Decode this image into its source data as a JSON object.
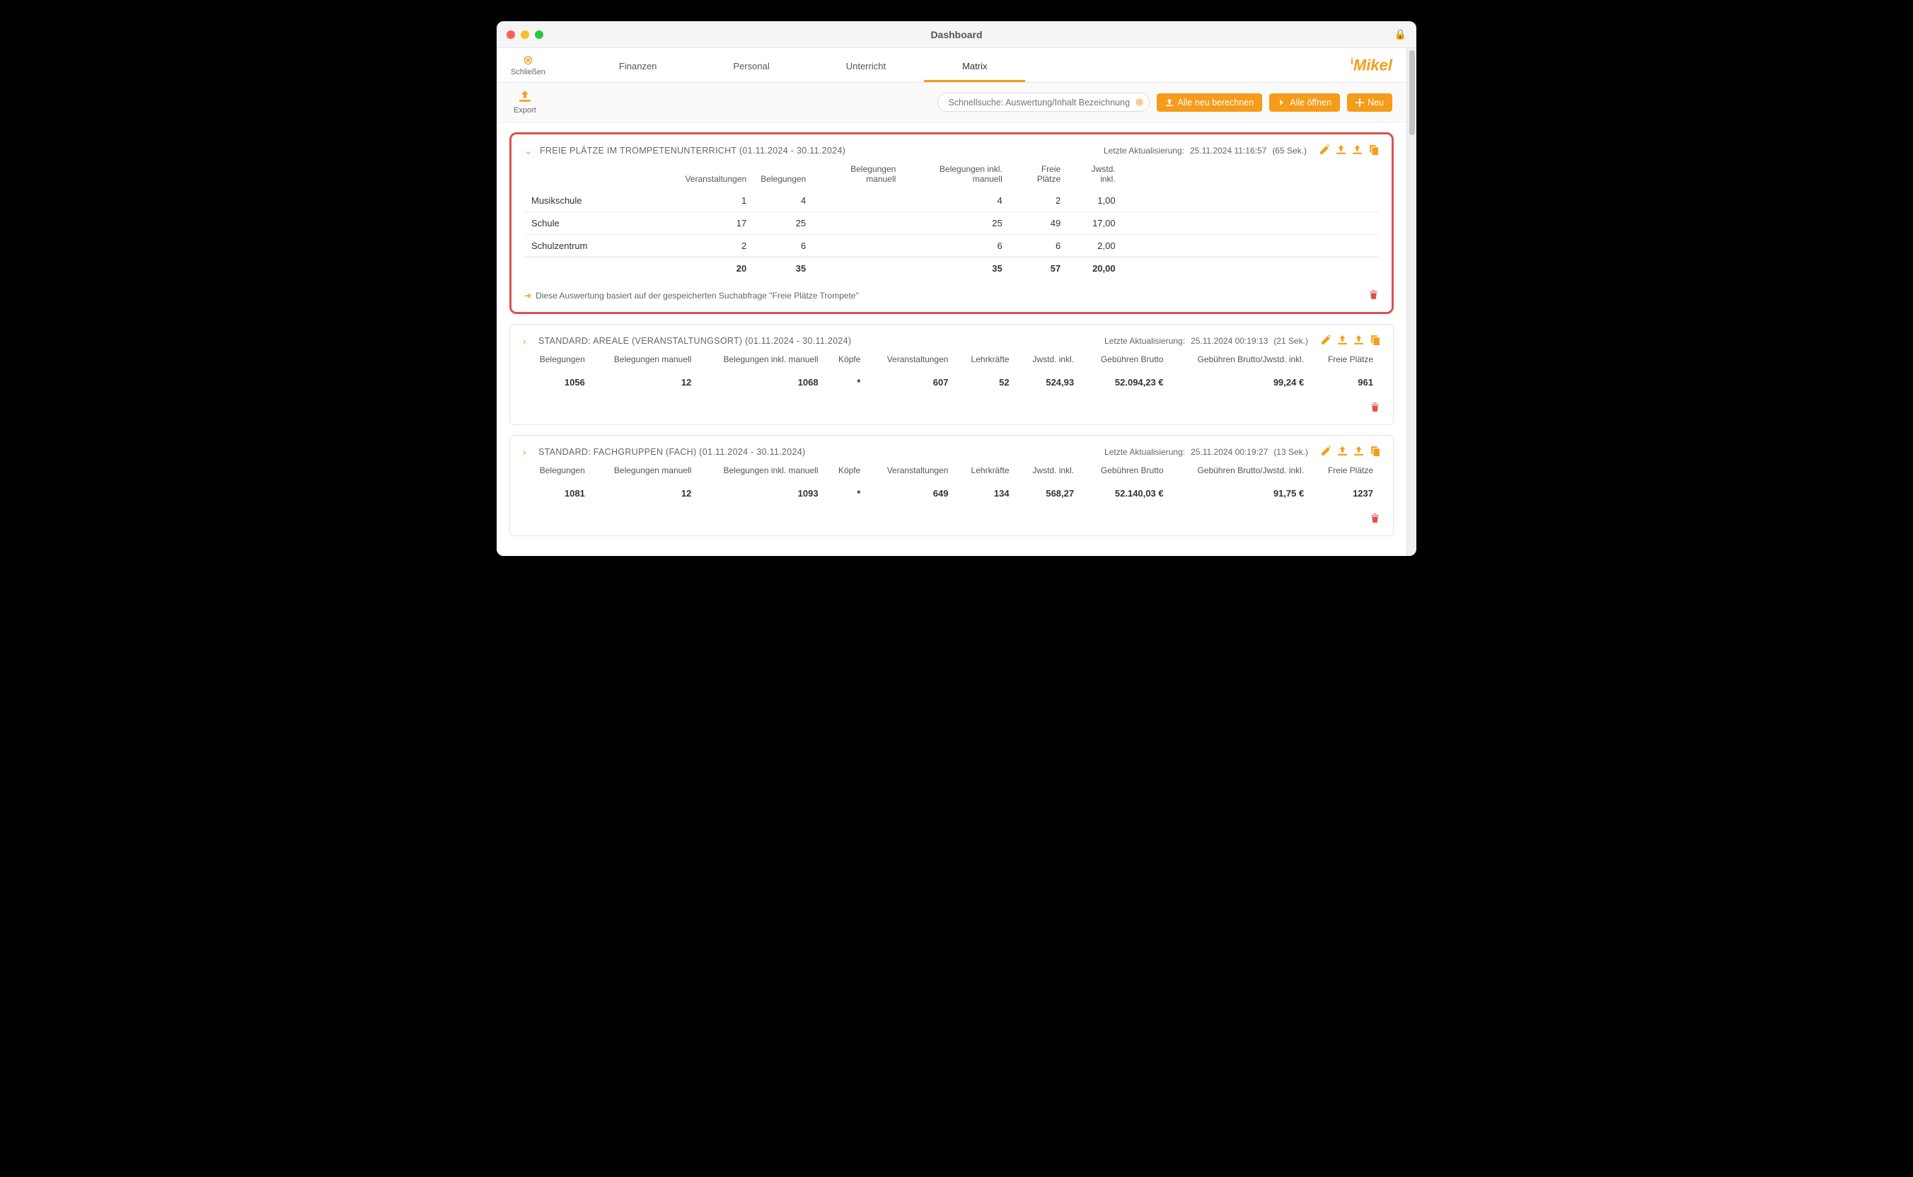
{
  "window": {
    "title": "Dashboard"
  },
  "toolbar": {
    "close_label": "Schließen",
    "export_label": "Export"
  },
  "tabs": {
    "finanzen": "Finanzen",
    "personal": "Personal",
    "unterricht": "Unterricht",
    "matrix": "Matrix"
  },
  "logo": "Mikel",
  "buttons": {
    "recalc": "Alle neu berechnen",
    "open_all": "Alle öffnen",
    "new": "Neu"
  },
  "search": {
    "placeholder": "Schnellsuche: Auswertung/Inhalt Bezeichnung"
  },
  "panel1": {
    "title": "FREIE PLÄTZE IM TROMPETENUNTERRICHT (01.11.2024 - 30.11.2024)",
    "meta_label": "Letzte Aktualisierung:",
    "meta_time": "25.11.2024 11:16:57",
    "meta_dur": "(65 Sek.)",
    "headers": {
      "c1": "Veranstaltungen",
      "c2": "Belegungen",
      "c3": "Belegungen manuell",
      "c4": "Belegungen inkl. manuell",
      "c5": "Freie Plätze",
      "c6": "Jwstd. inkl."
    },
    "rows": [
      {
        "label": "Musikschule",
        "c1": "1",
        "c2": "4",
        "c3": "",
        "c4": "4",
        "c5": "2",
        "c6": "1,00"
      },
      {
        "label": "Schule",
        "c1": "17",
        "c2": "25",
        "c3": "",
        "c4": "25",
        "c5": "49",
        "c6": "17,00"
      },
      {
        "label": "Schulzentrum",
        "c1": "2",
        "c2": "6",
        "c3": "",
        "c4": "6",
        "c5": "6",
        "c6": "2,00"
      }
    ],
    "total": {
      "c1": "20",
      "c2": "35",
      "c3": "",
      "c4": "35",
      "c5": "57",
      "c6": "20,00"
    },
    "footnote": "Diese Auswertung basiert auf der gespeicherten Suchabfrage \"Freie Plätze Trompete\""
  },
  "panel2": {
    "title": "STANDARD: AREALE (VERANSTALTUNGSORT) (01.11.2024 - 30.11.2024)",
    "meta_label": "Letzte Aktualisierung:",
    "meta_time": "25.11.2024 00:19:13",
    "meta_dur": "(21 Sek.)",
    "headers": {
      "c1": "Belegungen",
      "c2": "Belegungen manuell",
      "c3": "Belegungen inkl. manuell",
      "c4": "Köpfe",
      "c5": "Veranstaltungen",
      "c6": "Lehrkräfte",
      "c7": "Jwstd. inkl.",
      "c8": "Gebühren Brutto",
      "c9": "Gebühren Brutto/Jwstd. inkl.",
      "c10": "Freie Plätze"
    },
    "row": {
      "c1": "1056",
      "c2": "12",
      "c3": "1068",
      "c4": "*",
      "c5": "607",
      "c6": "52",
      "c7": "524,93",
      "c8": "52.094,23 €",
      "c9": "99,24 €",
      "c10": "961"
    }
  },
  "panel3": {
    "title": "STANDARD: FACHGRUPPEN (FACH) (01.11.2024 - 30.11.2024)",
    "meta_label": "Letzte Aktualisierung:",
    "meta_time": "25.11.2024 00:19:27",
    "meta_dur": "(13 Sek.)",
    "headers": {
      "c1": "Belegungen",
      "c2": "Belegungen manuell",
      "c3": "Belegungen inkl. manuell",
      "c4": "Köpfe",
      "c5": "Veranstaltungen",
      "c6": "Lehrkräfte",
      "c7": "Jwstd. inkl.",
      "c8": "Gebühren Brutto",
      "c9": "Gebühren Brutto/Jwstd. inkl.",
      "c10": "Freie Plätze"
    },
    "row": {
      "c1": "1081",
      "c2": "12",
      "c3": "1093",
      "c4": "*",
      "c5": "649",
      "c6": "134",
      "c7": "568,27",
      "c8": "52.140,03 €",
      "c9": "91,75 €",
      "c10": "1237"
    }
  }
}
